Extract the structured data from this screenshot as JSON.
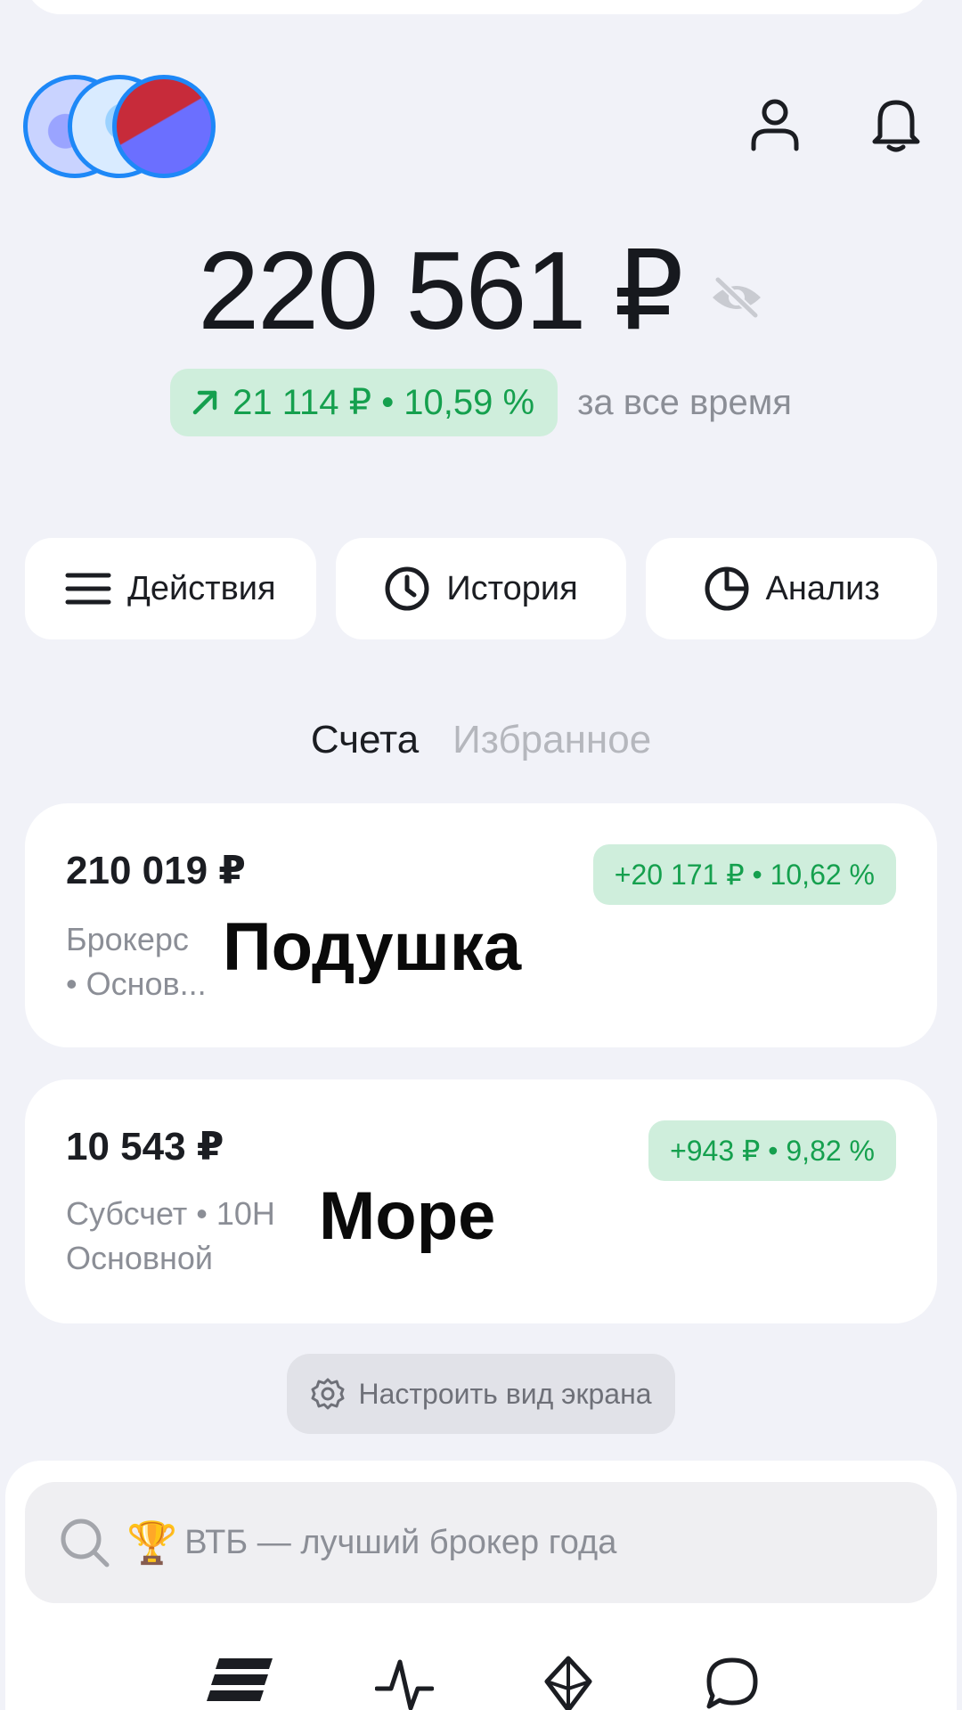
{
  "header": {
    "stories": [
      "story-chess",
      "story-puzzle",
      "story-store"
    ],
    "profile_icon": "person-icon",
    "notifications_icon": "bell-icon"
  },
  "portfolio": {
    "balance": "220 561 ₽",
    "hide_icon": "eye-off-icon",
    "gain": "21 114 ₽ • 10,59 %",
    "gain_period": "за все время"
  },
  "actions": [
    {
      "label": "Действия",
      "icon": "menu-icon"
    },
    {
      "label": "История",
      "icon": "clock-icon"
    },
    {
      "label": "Анализ",
      "icon": "pie-chart-icon"
    }
  ],
  "tabs": [
    {
      "label": "Счета",
      "active": true
    },
    {
      "label": "Избранное",
      "active": false
    }
  ],
  "accounts": [
    {
      "amount": "210 019 ₽",
      "change": "+20 171 ₽ • 10,62 %",
      "desc_line1": "Брокерс",
      "desc_line2": "• Основ...",
      "name": "Подушка"
    },
    {
      "amount": "10 543 ₽",
      "change": "+943 ₽ • 9,82 %",
      "desc_line1": "Субсчет • 10Н",
      "desc_line2": "Основной",
      "name": "Море"
    }
  ],
  "customize_label": "Настроить вид экрана",
  "search": {
    "trophy": "🏆",
    "text": "ВТБ — лучший брокер года"
  },
  "bottom_nav": [
    "portfolio-icon",
    "pulse-icon",
    "crystal-icon",
    "chat-icon"
  ],
  "colors": {
    "background": "#f1f2f8",
    "positive": "#15a04e",
    "positive_bg": "#cfeedc",
    "story_ring": "#1e88f7"
  }
}
